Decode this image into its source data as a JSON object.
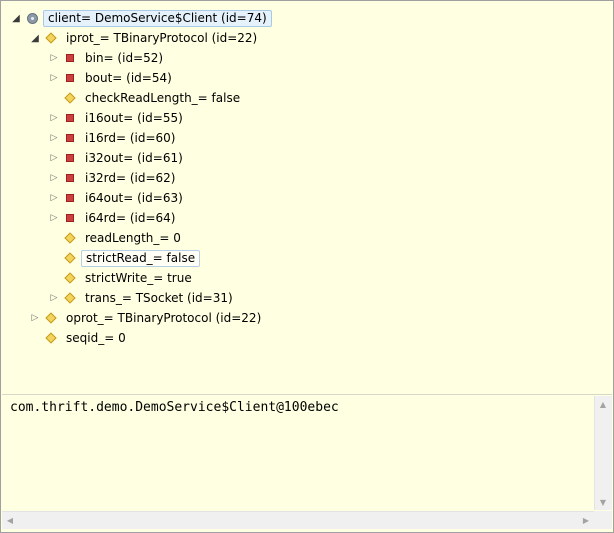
{
  "tree": {
    "items": [
      {
        "label": "client= DemoService$Client  (id=74)",
        "icon": "object-icon",
        "expander": "expanded",
        "level": 0,
        "state": "selected"
      },
      {
        "label": "iprot_= TBinaryProtocol  (id=22)",
        "icon": "field-icon",
        "expander": "expanded",
        "level": 1
      },
      {
        "label": "bin=  (id=52)",
        "icon": "private-field-icon",
        "expander": "collapsed",
        "level": 2
      },
      {
        "label": "bout=  (id=54)",
        "icon": "private-field-icon",
        "expander": "collapsed",
        "level": 2
      },
      {
        "label": "checkReadLength_= false",
        "icon": "field-icon",
        "expander": "none",
        "level": 2
      },
      {
        "label": "i16out=  (id=55)",
        "icon": "private-field-icon",
        "expander": "collapsed",
        "level": 2
      },
      {
        "label": "i16rd=  (id=60)",
        "icon": "private-field-icon",
        "expander": "collapsed",
        "level": 2
      },
      {
        "label": "i32out=  (id=61)",
        "icon": "private-field-icon",
        "expander": "collapsed",
        "level": 2
      },
      {
        "label": "i32rd=  (id=62)",
        "icon": "private-field-icon",
        "expander": "collapsed",
        "level": 2
      },
      {
        "label": "i64out=  (id=63)",
        "icon": "private-field-icon",
        "expander": "collapsed",
        "level": 2
      },
      {
        "label": "i64rd=  (id=64)",
        "icon": "private-field-icon",
        "expander": "collapsed",
        "level": 2
      },
      {
        "label": "readLength_= 0",
        "icon": "field-icon",
        "expander": "none",
        "level": 2
      },
      {
        "label": "strictRead_= false",
        "icon": "field-icon",
        "expander": "none",
        "level": 2,
        "state": "focused"
      },
      {
        "label": "strictWrite_= true",
        "icon": "field-icon",
        "expander": "none",
        "level": 2
      },
      {
        "label": "trans_= TSocket  (id=31)",
        "icon": "field-icon",
        "expander": "collapsed",
        "level": 2
      },
      {
        "label": "oprot_= TBinaryProtocol  (id=22)",
        "icon": "field-icon",
        "expander": "collapsed",
        "level": 1
      },
      {
        "label": "seqid_= 0",
        "icon": "field-icon",
        "expander": "none",
        "level": 1
      }
    ]
  },
  "details": {
    "text": "com.thrift.demo.DemoService$Client@100ebec"
  }
}
